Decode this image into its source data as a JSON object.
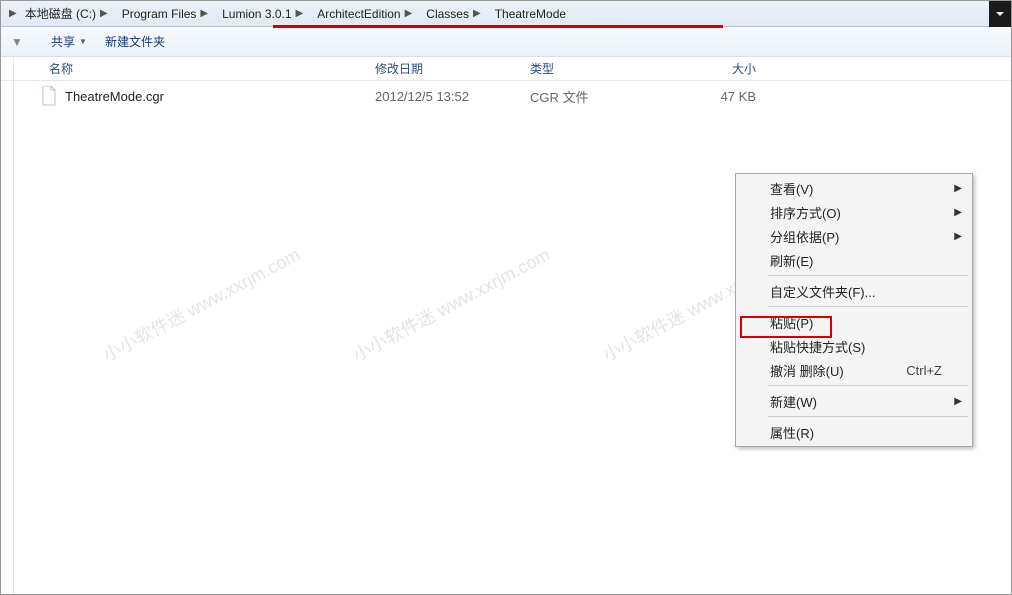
{
  "breadcrumb": [
    {
      "label": "本地磁盘 (C:)"
    },
    {
      "label": "Program Files"
    },
    {
      "label": "Lumion 3.0.1"
    },
    {
      "label": "ArchitectEdition"
    },
    {
      "label": "Classes"
    },
    {
      "label": "TheatreMode"
    }
  ],
  "toolbar": {
    "share_label": "共享",
    "newfolder_label": "新建文件夹"
  },
  "columns": {
    "name": "名称",
    "date": "修改日期",
    "type": "类型",
    "size": "大小"
  },
  "files": [
    {
      "name": "TheatreMode.cgr",
      "date": "2012/12/5 13:52",
      "type": "CGR 文件",
      "size": "47 KB"
    }
  ],
  "context_menu": {
    "view": "查看(V)",
    "sort": "排序方式(O)",
    "group": "分组依据(P)",
    "refresh": "刷新(E)",
    "customize": "自定义文件夹(F)...",
    "paste": "粘贴(P)",
    "paste_shortcut": "粘贴快捷方式(S)",
    "undo_delete": "撤消 删除(U)",
    "undo_delete_key": "Ctrl+Z",
    "new": "新建(W)",
    "properties": "属性(R)"
  },
  "watermark": {
    "line1": "www.xxrjm.com",
    "line2": "小小软件迷"
  }
}
